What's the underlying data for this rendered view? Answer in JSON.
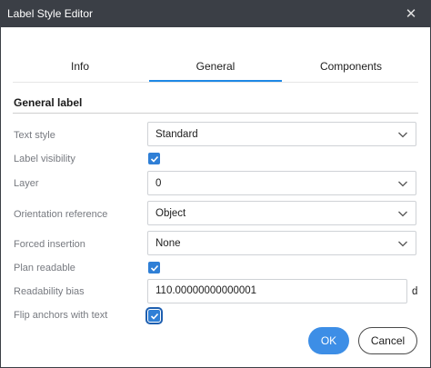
{
  "window": {
    "title": "Label Style Editor"
  },
  "tabs": [
    {
      "label": "Info",
      "active": false
    },
    {
      "label": "General",
      "active": true
    },
    {
      "label": "Components",
      "active": false
    }
  ],
  "section": {
    "title": "General label"
  },
  "fields": {
    "text_style": {
      "label": "Text style",
      "value": "Standard"
    },
    "label_visibility": {
      "label": "Label visibility",
      "checked": true
    },
    "layer": {
      "label": "Layer",
      "value": "0"
    },
    "orientation_reference": {
      "label": "Orientation reference",
      "value": "Object"
    },
    "forced_insertion": {
      "label": "Forced insertion",
      "value": "None"
    },
    "plan_readable": {
      "label": "Plan readable",
      "checked": true
    },
    "readability_bias": {
      "label": "Readability bias",
      "value": "110.00000000000001",
      "unit": "d"
    },
    "flip_anchors": {
      "label": "Flip anchors with text",
      "checked": true
    }
  },
  "buttons": {
    "ok": "OK",
    "cancel": "Cancel"
  },
  "colors": {
    "titlebar": "#3b3f46",
    "accent": "#1e88e5",
    "ok_button": "#3d8ee6",
    "checkbox": "#2f7fd6"
  },
  "icons": {
    "close": "close-icon",
    "dropdown": "chevron-down-icon",
    "check": "checkmark-icon"
  }
}
